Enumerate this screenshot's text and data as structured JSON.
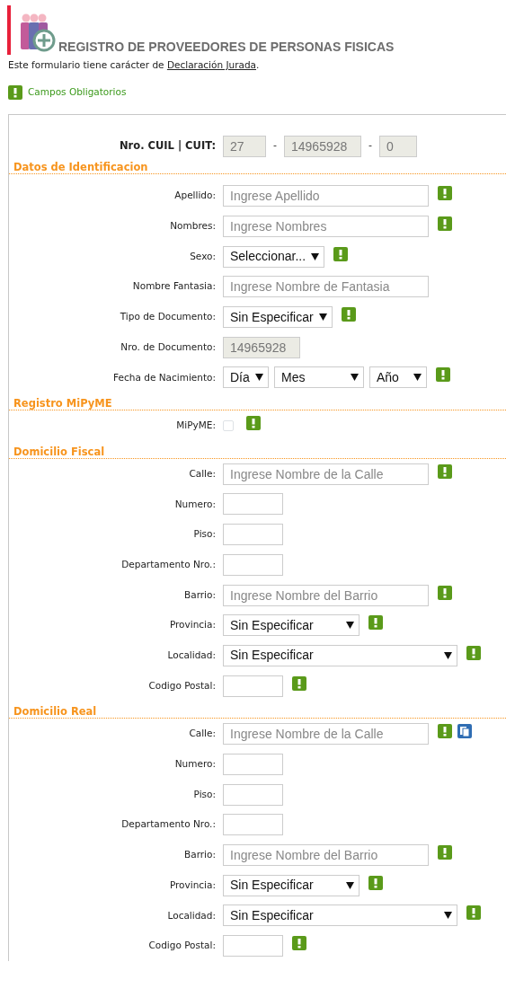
{
  "header": {
    "title": "REGISTRO DE PROVEEDORES DE PERSONAS FISICAS",
    "notice": "Este formulario tiene carácter de",
    "notice_link": "Declaración Jurada",
    "notice_end": ".",
    "legend": "Campos Obligatorios"
  },
  "cuil": {
    "label": "Nro. CUIL | CUIT:",
    "parts": [
      "27",
      "14965928",
      "0"
    ],
    "separators": [
      "-",
      "-"
    ]
  },
  "sections": [
    {
      "title": "Datos de Identificacion",
      "fields": [
        {
          "kind": "text",
          "label": "Apellido:",
          "placeholder": "Ingrese Apellido",
          "required": true
        },
        {
          "kind": "text",
          "label": "Nombres:",
          "placeholder": "Ingrese Nombres",
          "required": true
        },
        {
          "kind": "select",
          "label": "Sexo:",
          "value": "Seleccionar...",
          "required": true
        },
        {
          "kind": "text",
          "label": "Nombre Fantasia:",
          "placeholder": "Ingrese Nombre de Fantasia",
          "required": false
        },
        {
          "kind": "select",
          "label": "Tipo de Documento:",
          "value": "Sin Especificar",
          "required": true
        },
        {
          "kind": "readonly",
          "label": "Nro. de Documento:",
          "value": "14965928",
          "required": false
        },
        {
          "kind": "date",
          "label": "Fecha de Nacimiento:",
          "parts": [
            "Día",
            "Mes",
            "Año"
          ],
          "required": true
        }
      ]
    },
    {
      "title": "Registro MiPyME",
      "fields": [
        {
          "kind": "checkbox",
          "label": "MiPyME:",
          "checked": false,
          "required": true
        }
      ]
    },
    {
      "title": "Domicilio Fiscal",
      "fields": [
        {
          "kind": "text",
          "label": "Calle:",
          "placeholder": "Ingrese Nombre de la Calle",
          "required": true
        },
        {
          "kind": "short",
          "label": "Numero:",
          "required": false
        },
        {
          "kind": "short",
          "label": "Piso:",
          "required": false
        },
        {
          "kind": "short",
          "label": "Departamento Nro.:",
          "required": false
        },
        {
          "kind": "text",
          "label": "Barrio:",
          "placeholder": "Ingrese Nombre del Barrio",
          "required": true
        },
        {
          "kind": "select_md",
          "label": "Provincia:",
          "value": "Sin Especificar",
          "required": true
        },
        {
          "kind": "select_lg",
          "label": "Localidad:",
          "value": "Sin Especificar",
          "required": true
        },
        {
          "kind": "short",
          "label": "Codigo Postal:",
          "required": true
        }
      ]
    },
    {
      "title": "Domicilio Real",
      "fields": [
        {
          "kind": "text",
          "label": "Calle:",
          "placeholder": "Ingrese Nombre de la Calle",
          "required": true,
          "copy": true
        },
        {
          "kind": "short",
          "label": "Numero:",
          "required": false
        },
        {
          "kind": "short",
          "label": "Piso:",
          "required": false
        },
        {
          "kind": "short",
          "label": "Departamento Nro.:",
          "required": false
        },
        {
          "kind": "text",
          "label": "Barrio:",
          "placeholder": "Ingrese Nombre del Barrio",
          "required": true
        },
        {
          "kind": "select_md",
          "label": "Provincia:",
          "value": "Sin Especificar",
          "required": true
        },
        {
          "kind": "select_lg",
          "label": "Localidad:",
          "value": "Sin Especificar",
          "required": true
        },
        {
          "kind": "short",
          "label": "Codigo Postal:",
          "required": true
        }
      ]
    }
  ]
}
